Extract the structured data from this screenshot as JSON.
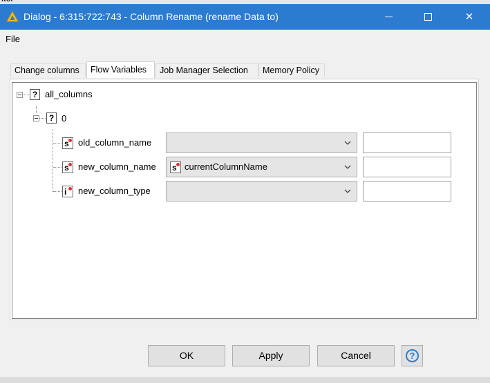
{
  "window": {
    "title": "Dialog - 6:315:722:743 - Column Rename (rename Data to)",
    "minimize_icon": "minimize-icon",
    "maximize_icon": "maximize-icon",
    "close_glyph": "✕",
    "accent": "#2b7bd0"
  },
  "menu": {
    "file": "File"
  },
  "tabs": [
    {
      "label": "Change columns",
      "active": false
    },
    {
      "label": "Flow Variables",
      "active": true
    },
    {
      "label": "Job Manager Selection",
      "active": false
    },
    {
      "label": "Memory Policy",
      "active": false
    }
  ],
  "tree": {
    "root": {
      "icon_glyph": "?",
      "label": "all_columns"
    },
    "child": {
      "icon_glyph": "?",
      "label": "0"
    },
    "rows": [
      {
        "icon_glyph": "s",
        "label": "old_column_name",
        "selected": "",
        "selected_icon": "",
        "text": ""
      },
      {
        "icon_glyph": "s",
        "label": "new_column_name",
        "selected": "currentColumnName",
        "selected_icon": "s",
        "text": ""
      },
      {
        "icon_glyph": "i",
        "label": "new_column_type",
        "selected": "",
        "selected_icon": "",
        "text": ""
      }
    ]
  },
  "buttons": {
    "ok": "OK",
    "apply": "Apply",
    "cancel": "Cancel",
    "help_glyph": "?"
  }
}
